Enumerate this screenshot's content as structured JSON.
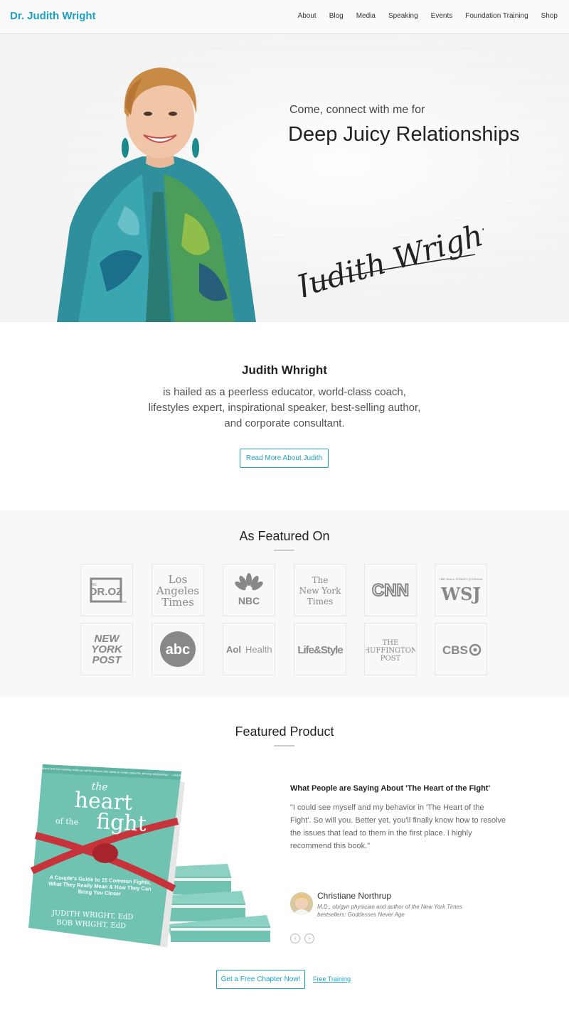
{
  "nav": {
    "brand": "Dr. Judith Wright",
    "items": [
      "About",
      "Blog",
      "Media",
      "Speaking",
      "Events",
      "Foundation Training",
      "Shop"
    ]
  },
  "hero": {
    "kicker": "Come, connect with me for",
    "title": "Deep Juicy Relationships",
    "signature_text": "Judith Wright"
  },
  "about": {
    "name": "Judith Whright",
    "description": "is hailed as a peerless educator, world-class coach, lifestyles expert, inspirational speaker, best-selling author, and corporate consultant.",
    "button": "Read More About Judith"
  },
  "featured_on": {
    "title": "As Featured On",
    "logos": [
      {
        "name": "dr-oz-show",
        "text": "THE DR.OZ SHOW"
      },
      {
        "name": "los-angeles-times",
        "text": "Los Angeles Times"
      },
      {
        "name": "nbc",
        "text": "NBC"
      },
      {
        "name": "new-york-times",
        "text": "The New York Times"
      },
      {
        "name": "cnn",
        "text": "CNN"
      },
      {
        "name": "wsj",
        "text": "WSJ"
      },
      {
        "name": "new-york-post",
        "text": "NEW YORK POST"
      },
      {
        "name": "abc",
        "text": "abc"
      },
      {
        "name": "aol-health",
        "text": "Aol Health"
      },
      {
        "name": "life-and-style",
        "text": "Life&Style"
      },
      {
        "name": "huffington-post",
        "text": "THE HUFFINGTON POST"
      },
      {
        "name": "cbs",
        "text": "CBS"
      }
    ]
  },
  "product": {
    "title": "Featured Product",
    "book": {
      "blurb": "\"An inspirational and eye-opening wake-up call for anyone who wants to create authentic, thriving relationships.\" —JACK CANFIELD",
      "title_the": "the",
      "title_heart": "heart",
      "title_of_the": "of the",
      "title_fight": "fight",
      "subtitle": "A Couple's Guide to 15 Common Fights, What They Really Mean & How They Can Bring You Closer",
      "author1": "JUDITH WRIGHT, EdD",
      "author2": "BOB WRIGHT, EdD"
    },
    "testimonial": {
      "heading": "What People are Saying About 'The Heart of the Fight'",
      "quote": "\"I could see myself and my behavior in 'The Heart of the Fight'. So will you. Better yet, you'll finally know how to resolve the issues that lead to them in the first place. I highly recommend this book.\"",
      "author": "Christiane Northrup",
      "author_desc": "M.D., ob/gyn physician and author of the New York Times bestsellers: Goddesses Never Age"
    },
    "arrows": {
      "prev": "‹",
      "next": "›"
    },
    "cta_button": "Get a Free Chapter Now!",
    "cta_link": "Free Training"
  },
  "colors": {
    "accent": "#1ba1c4",
    "book_teal": "#6fc3b0",
    "ribbon_red": "#c8323a"
  }
}
